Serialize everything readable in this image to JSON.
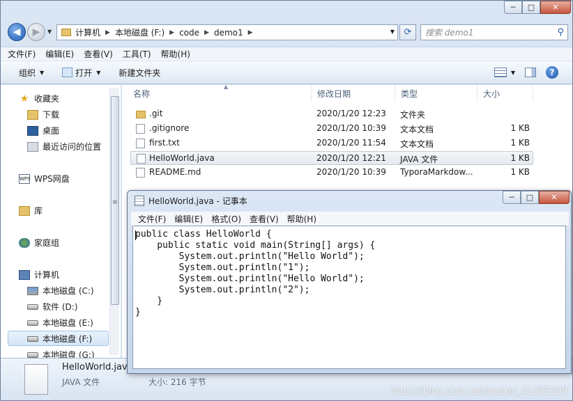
{
  "window": {
    "min": "─",
    "max": "□",
    "close": "✕"
  },
  "nav": {
    "back": "◀",
    "forward": "▶"
  },
  "address": {
    "crumbs": [
      "计算机",
      "本地磁盘 (F:)",
      "code",
      "demo1"
    ],
    "sep": "▶"
  },
  "search": {
    "placeholder": "搜索 demo1"
  },
  "menu": [
    "文件(F)",
    "编辑(E)",
    "查看(V)",
    "工具(T)",
    "帮助(H)"
  ],
  "toolbar": {
    "organize": "组织",
    "open": "打开",
    "new_folder": "新建文件夹",
    "help": "?"
  },
  "sidebar": {
    "favorites": "收藏夹",
    "downloads": "下载",
    "desktop": "桌面",
    "recent": "最近访问的位置",
    "wps": "WPS网盘",
    "library": "库",
    "homegroup": "家庭组",
    "computer": "计算机",
    "drives": [
      "本地磁盘 (C:)",
      "软件 (D:)",
      "本地磁盘 (E:)",
      "本地磁盘 (F:)",
      "本地磁盘 (G:)"
    ]
  },
  "columns": {
    "name": "名称",
    "date": "修改日期",
    "type": "类型",
    "size": "大小"
  },
  "files": [
    {
      "name": ".git",
      "date": "2020/1/20 12:23",
      "type": "文件夹",
      "size": ""
    },
    {
      "name": ".gitignore",
      "date": "2020/1/20 10:39",
      "type": "文本文档",
      "size": "1 KB"
    },
    {
      "name": "first.txt",
      "date": "2020/1/20 11:54",
      "type": "文本文档",
      "size": "1 KB"
    },
    {
      "name": "HelloWorld.java",
      "date": "2020/1/20 12:21",
      "type": "JAVA 文件",
      "size": "1 KB"
    },
    {
      "name": "README.md",
      "date": "2020/1/20 10:39",
      "type": "TyporaMarkdow...",
      "size": "1 KB"
    }
  ],
  "details": {
    "name": "HelloWorld.java",
    "type": "JAVA 文件",
    "size": "大小: 216 字节"
  },
  "notepad": {
    "title": "HelloWorld.java - 记事本",
    "menu": [
      "文件(F)",
      "编辑(E)",
      "格式(O)",
      "查看(V)",
      "帮助(H)"
    ],
    "content": "public class HelloWorld {\n    public static void main(String[] args) {\n        System.out.println(\"Hello World\");\n        System.out.println(\"1\");\n        System.out.println(\"Hello World\");\n        System.out.println(\"2\");\n    }\n}"
  },
  "watermark": "https://blog.csdn.net/weixin_41585309"
}
